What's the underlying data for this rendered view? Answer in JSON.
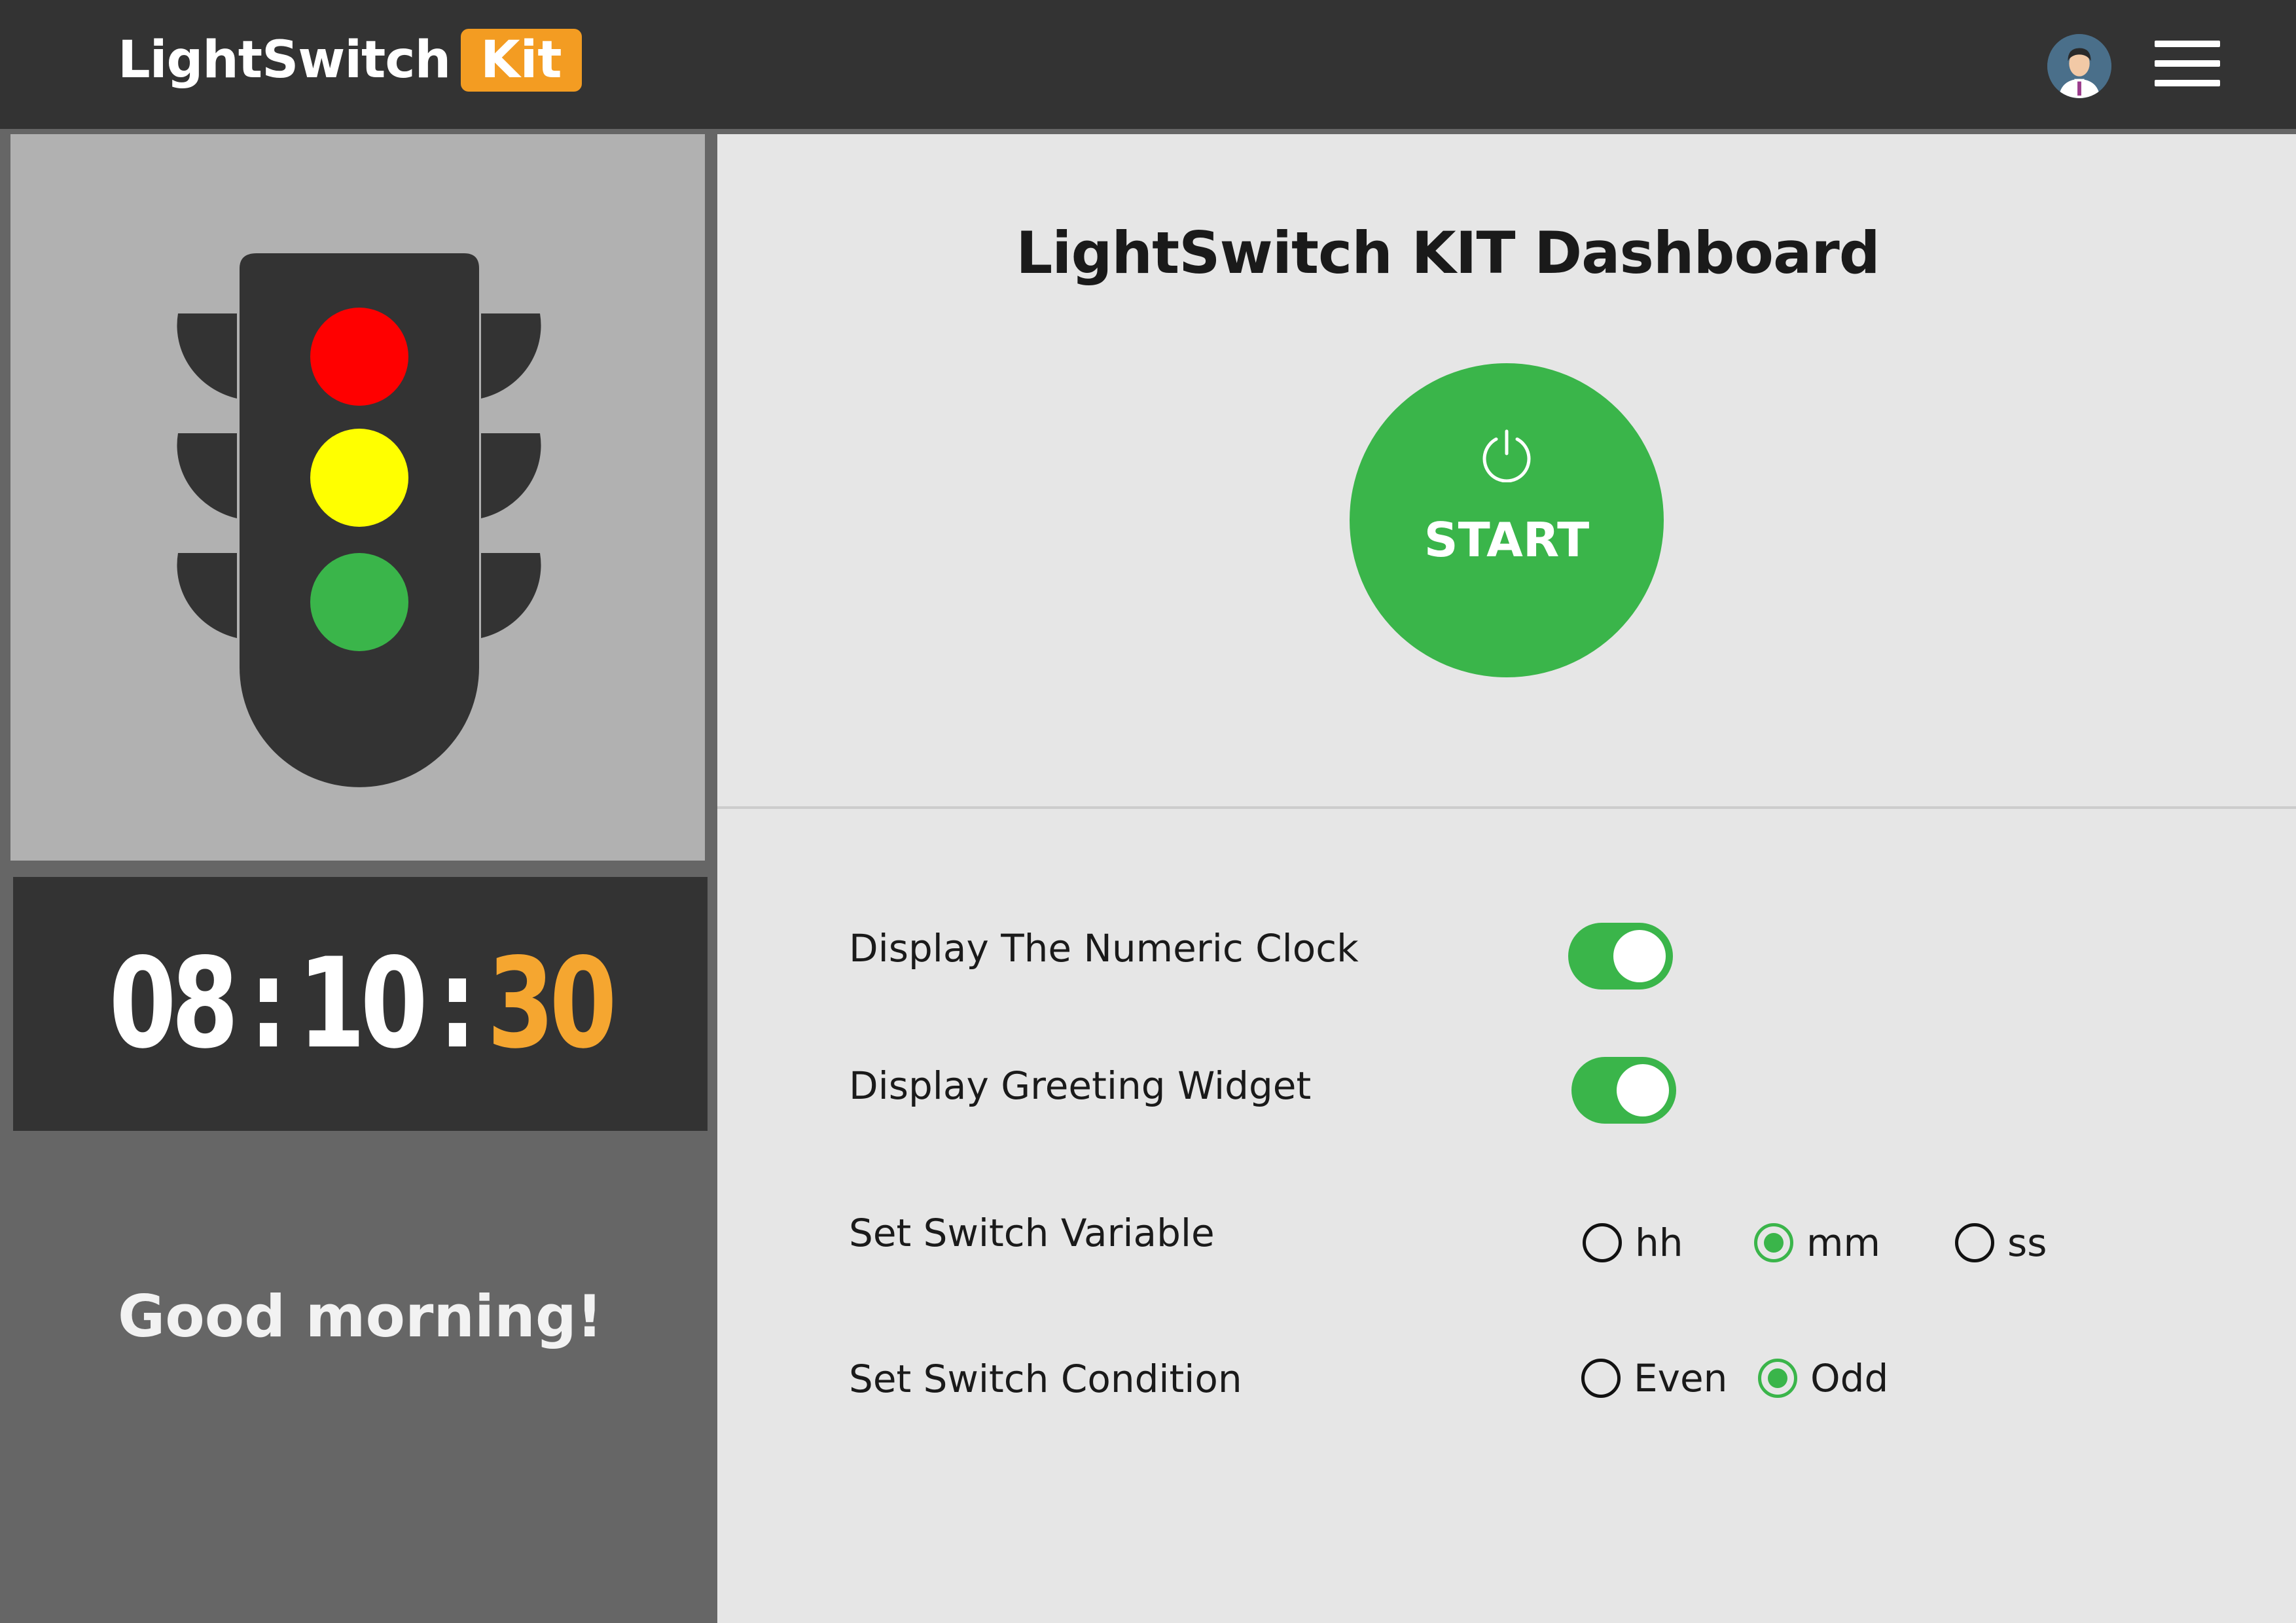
{
  "header": {
    "logo_text": "LightSwitch",
    "logo_badge": "Kit",
    "avatar_icon": "user-avatar-icon",
    "menu_icon": "hamburger-menu-icon"
  },
  "traffic_light": {
    "lights": [
      "red",
      "yellow",
      "green"
    ],
    "colors": {
      "red": "#ff0000",
      "yellow": "#ffff00",
      "green": "#3ab54a",
      "body": "#333333"
    }
  },
  "clock": {
    "hours": "08",
    "minutes": "10",
    "seconds": "30",
    "separator": ":"
  },
  "greeting": "Good morning!",
  "dashboard": {
    "title": "LightSwitch KIT Dashboard",
    "start_label": "START",
    "start_icon": "power-icon"
  },
  "settings": {
    "numeric_clock": {
      "label": "Display The Numeric Clock",
      "enabled": true
    },
    "greeting_widget": {
      "label": "Display Greeting Widget",
      "enabled": true
    },
    "switch_variable": {
      "label": "Set Switch Variable",
      "options": [
        "hh",
        "mm",
        "ss"
      ],
      "selected": "mm"
    },
    "switch_condition": {
      "label": "Set Switch Condition",
      "options": [
        "Even",
        "Odd"
      ],
      "selected": "Odd"
    }
  },
  "colors": {
    "accent_green": "#3ab54a",
    "accent_orange": "#f39c22",
    "dark": "#333333"
  }
}
